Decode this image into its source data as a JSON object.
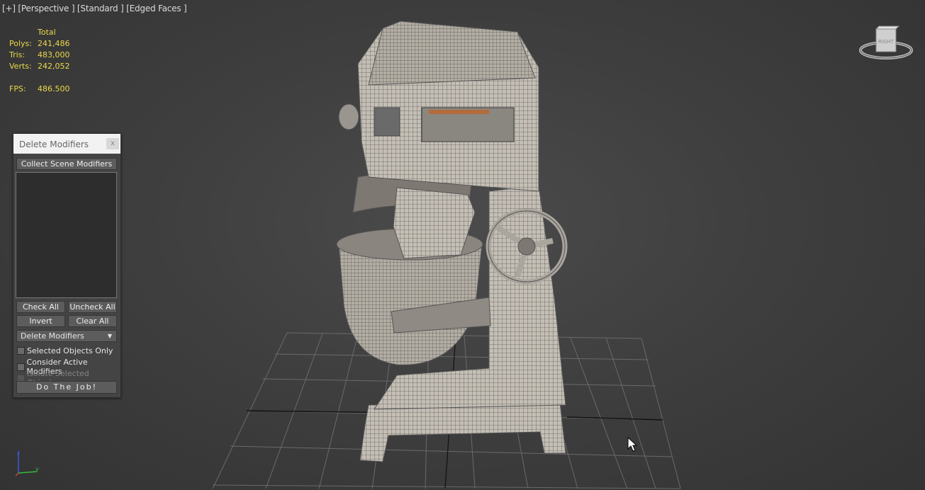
{
  "viewport": {
    "label": "[+] [Perspective ] [Standard ] [Edged Faces ]",
    "stats": {
      "header": "Total",
      "rows": [
        {
          "label": "Polys:",
          "value": "241,486"
        },
        {
          "label": "Tris:",
          "value": "483,000"
        },
        {
          "label": "Verts:",
          "value": "242,052"
        }
      ],
      "fps_label": "FPS:",
      "fps_value": "486.500"
    },
    "viewcube_label": "RIGHT",
    "axis": {
      "z": "z",
      "y": "y"
    }
  },
  "dialog": {
    "title": "Delete Modifiers",
    "close_label": "x",
    "collect_label": "Collect Scene Modifiers",
    "check_all": "Check All",
    "uncheck_all": "Uncheck All",
    "invert": "Invert",
    "clear_all": "Clear All",
    "dropdown_value": "Delete Modifiers",
    "options": {
      "selected_only": "Selected Objects Only",
      "consider_active": "Consider Active Modifiers",
      "isolate_selected": "Isolate Selected Objects"
    },
    "do_job": "Do The Job!"
  },
  "colors": {
    "stats": "#e9d84a",
    "viewport_bg": "#444444",
    "dialog_bg": "#444444",
    "mesh": "#bdb7ad"
  }
}
